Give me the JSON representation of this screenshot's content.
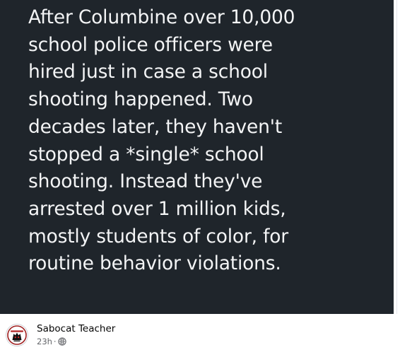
{
  "post": {
    "image_text_lines": [
      "After Columbine over 10,000",
      "school police officers were",
      "hired just in case a school",
      "shooting happened. Two",
      "decades later, they haven't",
      "stopped a *single* school",
      "shooting. Instead they've",
      "arrested over 1 million kids,",
      "mostly students of color, for",
      "routine behavior violations."
    ],
    "author_name": "Sabocat Teacher",
    "timestamp": "23h",
    "separator": "·",
    "audience_icon": "globe-icon"
  },
  "colors": {
    "image_background": "#1f252b",
    "image_text": "#f3f4f5",
    "name_text": "#050505",
    "meta_text": "#65676b"
  }
}
